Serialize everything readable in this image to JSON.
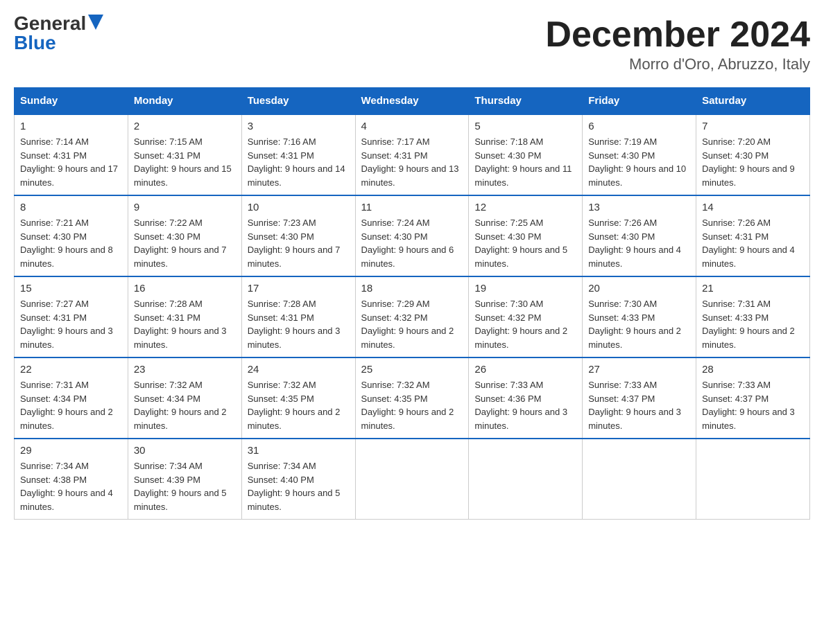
{
  "logo": {
    "general": "General",
    "blue": "Blue"
  },
  "title": {
    "month_year": "December 2024",
    "location": "Morro d'Oro, Abruzzo, Italy"
  },
  "headers": [
    "Sunday",
    "Monday",
    "Tuesday",
    "Wednesday",
    "Thursday",
    "Friday",
    "Saturday"
  ],
  "weeks": [
    [
      {
        "day": "1",
        "sunrise": "Sunrise: 7:14 AM",
        "sunset": "Sunset: 4:31 PM",
        "daylight": "Daylight: 9 hours and 17 minutes."
      },
      {
        "day": "2",
        "sunrise": "Sunrise: 7:15 AM",
        "sunset": "Sunset: 4:31 PM",
        "daylight": "Daylight: 9 hours and 15 minutes."
      },
      {
        "day": "3",
        "sunrise": "Sunrise: 7:16 AM",
        "sunset": "Sunset: 4:31 PM",
        "daylight": "Daylight: 9 hours and 14 minutes."
      },
      {
        "day": "4",
        "sunrise": "Sunrise: 7:17 AM",
        "sunset": "Sunset: 4:31 PM",
        "daylight": "Daylight: 9 hours and 13 minutes."
      },
      {
        "day": "5",
        "sunrise": "Sunrise: 7:18 AM",
        "sunset": "Sunset: 4:30 PM",
        "daylight": "Daylight: 9 hours and 11 minutes."
      },
      {
        "day": "6",
        "sunrise": "Sunrise: 7:19 AM",
        "sunset": "Sunset: 4:30 PM",
        "daylight": "Daylight: 9 hours and 10 minutes."
      },
      {
        "day": "7",
        "sunrise": "Sunrise: 7:20 AM",
        "sunset": "Sunset: 4:30 PM",
        "daylight": "Daylight: 9 hours and 9 minutes."
      }
    ],
    [
      {
        "day": "8",
        "sunrise": "Sunrise: 7:21 AM",
        "sunset": "Sunset: 4:30 PM",
        "daylight": "Daylight: 9 hours and 8 minutes."
      },
      {
        "day": "9",
        "sunrise": "Sunrise: 7:22 AM",
        "sunset": "Sunset: 4:30 PM",
        "daylight": "Daylight: 9 hours and 7 minutes."
      },
      {
        "day": "10",
        "sunrise": "Sunrise: 7:23 AM",
        "sunset": "Sunset: 4:30 PM",
        "daylight": "Daylight: 9 hours and 7 minutes."
      },
      {
        "day": "11",
        "sunrise": "Sunrise: 7:24 AM",
        "sunset": "Sunset: 4:30 PM",
        "daylight": "Daylight: 9 hours and 6 minutes."
      },
      {
        "day": "12",
        "sunrise": "Sunrise: 7:25 AM",
        "sunset": "Sunset: 4:30 PM",
        "daylight": "Daylight: 9 hours and 5 minutes."
      },
      {
        "day": "13",
        "sunrise": "Sunrise: 7:26 AM",
        "sunset": "Sunset: 4:30 PM",
        "daylight": "Daylight: 9 hours and 4 minutes."
      },
      {
        "day": "14",
        "sunrise": "Sunrise: 7:26 AM",
        "sunset": "Sunset: 4:31 PM",
        "daylight": "Daylight: 9 hours and 4 minutes."
      }
    ],
    [
      {
        "day": "15",
        "sunrise": "Sunrise: 7:27 AM",
        "sunset": "Sunset: 4:31 PM",
        "daylight": "Daylight: 9 hours and 3 minutes."
      },
      {
        "day": "16",
        "sunrise": "Sunrise: 7:28 AM",
        "sunset": "Sunset: 4:31 PM",
        "daylight": "Daylight: 9 hours and 3 minutes."
      },
      {
        "day": "17",
        "sunrise": "Sunrise: 7:28 AM",
        "sunset": "Sunset: 4:31 PM",
        "daylight": "Daylight: 9 hours and 3 minutes."
      },
      {
        "day": "18",
        "sunrise": "Sunrise: 7:29 AM",
        "sunset": "Sunset: 4:32 PM",
        "daylight": "Daylight: 9 hours and 2 minutes."
      },
      {
        "day": "19",
        "sunrise": "Sunrise: 7:30 AM",
        "sunset": "Sunset: 4:32 PM",
        "daylight": "Daylight: 9 hours and 2 minutes."
      },
      {
        "day": "20",
        "sunrise": "Sunrise: 7:30 AM",
        "sunset": "Sunset: 4:33 PM",
        "daylight": "Daylight: 9 hours and 2 minutes."
      },
      {
        "day": "21",
        "sunrise": "Sunrise: 7:31 AM",
        "sunset": "Sunset: 4:33 PM",
        "daylight": "Daylight: 9 hours and 2 minutes."
      }
    ],
    [
      {
        "day": "22",
        "sunrise": "Sunrise: 7:31 AM",
        "sunset": "Sunset: 4:34 PM",
        "daylight": "Daylight: 9 hours and 2 minutes."
      },
      {
        "day": "23",
        "sunrise": "Sunrise: 7:32 AM",
        "sunset": "Sunset: 4:34 PM",
        "daylight": "Daylight: 9 hours and 2 minutes."
      },
      {
        "day": "24",
        "sunrise": "Sunrise: 7:32 AM",
        "sunset": "Sunset: 4:35 PM",
        "daylight": "Daylight: 9 hours and 2 minutes."
      },
      {
        "day": "25",
        "sunrise": "Sunrise: 7:32 AM",
        "sunset": "Sunset: 4:35 PM",
        "daylight": "Daylight: 9 hours and 2 minutes."
      },
      {
        "day": "26",
        "sunrise": "Sunrise: 7:33 AM",
        "sunset": "Sunset: 4:36 PM",
        "daylight": "Daylight: 9 hours and 3 minutes."
      },
      {
        "day": "27",
        "sunrise": "Sunrise: 7:33 AM",
        "sunset": "Sunset: 4:37 PM",
        "daylight": "Daylight: 9 hours and 3 minutes."
      },
      {
        "day": "28",
        "sunrise": "Sunrise: 7:33 AM",
        "sunset": "Sunset: 4:37 PM",
        "daylight": "Daylight: 9 hours and 3 minutes."
      }
    ],
    [
      {
        "day": "29",
        "sunrise": "Sunrise: 7:34 AM",
        "sunset": "Sunset: 4:38 PM",
        "daylight": "Daylight: 9 hours and 4 minutes."
      },
      {
        "day": "30",
        "sunrise": "Sunrise: 7:34 AM",
        "sunset": "Sunset: 4:39 PM",
        "daylight": "Daylight: 9 hours and 5 minutes."
      },
      {
        "day": "31",
        "sunrise": "Sunrise: 7:34 AM",
        "sunset": "Sunset: 4:40 PM",
        "daylight": "Daylight: 9 hours and 5 minutes."
      },
      null,
      null,
      null,
      null
    ]
  ]
}
